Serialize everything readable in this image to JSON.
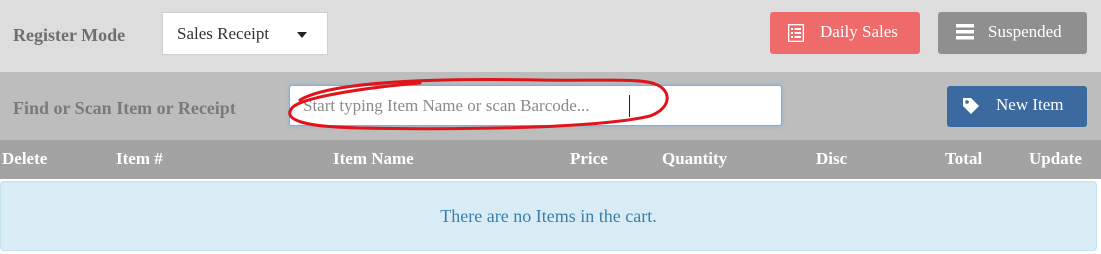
{
  "register": {
    "label": "Register Mode",
    "mode_value": "Sales Receipt"
  },
  "toolbar": {
    "daily_sales_label": "Daily Sales",
    "daily_sales_icon": "list-icon",
    "suspended_label": "Suspended",
    "suspended_icon": "stack-icon"
  },
  "find": {
    "label": "Find or Scan Item or Receipt",
    "placeholder": "Start typing Item Name or scan Barcode...",
    "new_item_label": "New Item",
    "new_item_icon": "tag-icon"
  },
  "table": {
    "columns": [
      "Delete",
      "Item #",
      "Item Name",
      "Price",
      "Quantity",
      "Disc",
      "Total",
      "Update"
    ],
    "empty_message": "There are no Items in the cart."
  },
  "colors": {
    "daily_sales": "#ef6b6b",
    "suspended": "#8f8f8f",
    "new_item": "#3a6a9f",
    "empty_bg": "#d9ecf6",
    "annotation": "#e0141b"
  }
}
